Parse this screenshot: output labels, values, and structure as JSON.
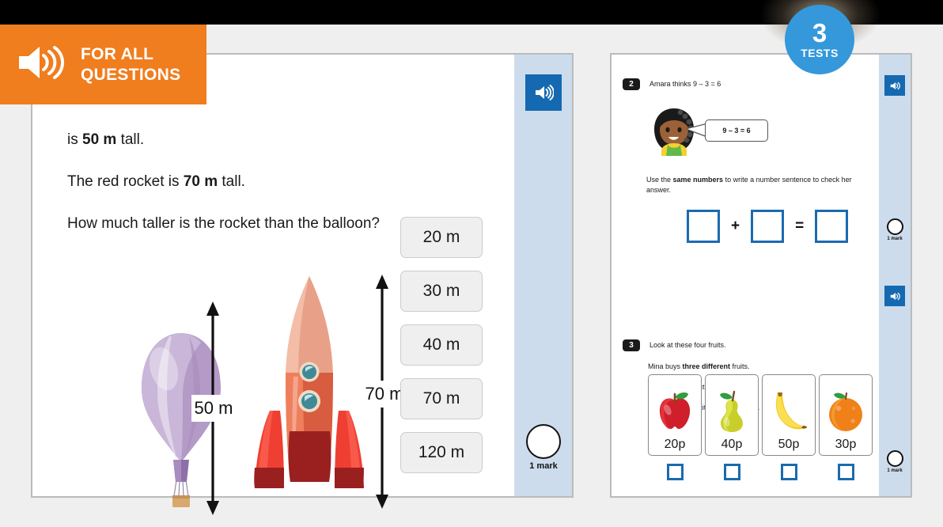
{
  "overlay_badge": {
    "icon": "speaker-icon",
    "line1": "FOR ALL",
    "line2": "QUESTIONS",
    "color": "#f07d1e"
  },
  "tests_badge": {
    "number": "3",
    "label": "TESTS",
    "color": "#3498db"
  },
  "left_worksheet": {
    "question_lines": [
      {
        "prefix": "",
        "bold": "",
        "text": "is ",
        "bold_text": "50 m",
        "suffix": " tall."
      },
      {
        "text": "The red rocket is ",
        "bold_text": "70 m",
        "suffix": " tall."
      },
      {
        "text": "How much taller is the rocket than the balloon?",
        "bold_text": "",
        "suffix": ""
      }
    ],
    "line1_text": "is ",
    "line1_bold": "50 m",
    "line1_suffix": " tall.",
    "line2_text": "The red rocket is ",
    "line2_bold": "70 m",
    "line2_suffix": " tall.",
    "line3_text": "How much taller is the rocket than the balloon?",
    "illustration": {
      "balloon_label": "50 m",
      "rocket_label": "70 m"
    },
    "options": [
      {
        "label": "20 m"
      },
      {
        "label": "30 m"
      },
      {
        "label": "40 m"
      },
      {
        "label": "70 m"
      },
      {
        "label": "120 m"
      }
    ],
    "speaker_icon": "speaker-icon",
    "mark": {
      "label": "1 mark"
    }
  },
  "right_worksheet": {
    "question2": {
      "number": "2",
      "heading": "Amara thinks 9 – 3 = 6",
      "speech_bubble": "9 – 3 = 6",
      "instruction_part1": "Use the ",
      "instruction_bold": "same numbers",
      "instruction_part2": " to write a number sentence to check her answer.",
      "operators": {
        "plus": "+",
        "equals": "="
      },
      "speaker_icon": "speaker-icon",
      "mark": {
        "label": "1 mark"
      }
    },
    "question3": {
      "number": "3",
      "line1": "Look at these four fruits.",
      "line2_part1": "Mina buys ",
      "line2_bold": "three different",
      "line2_part2": " fruits.",
      "line3_part1": "She spends exactly ",
      "line3_bold": "£1",
      "line4_part1": "Tick the ",
      "line4_bold": "three",
      "line4_part2": " fruits that Mina buys.",
      "fruits": [
        {
          "name": "apple",
          "price": "20p"
        },
        {
          "name": "pear",
          "price": "40p"
        },
        {
          "name": "banana",
          "price": "50p"
        },
        {
          "name": "orange",
          "price": "30p"
        }
      ],
      "speaker_icon": "speaker-icon",
      "mark": {
        "label": "1 mark"
      }
    }
  }
}
